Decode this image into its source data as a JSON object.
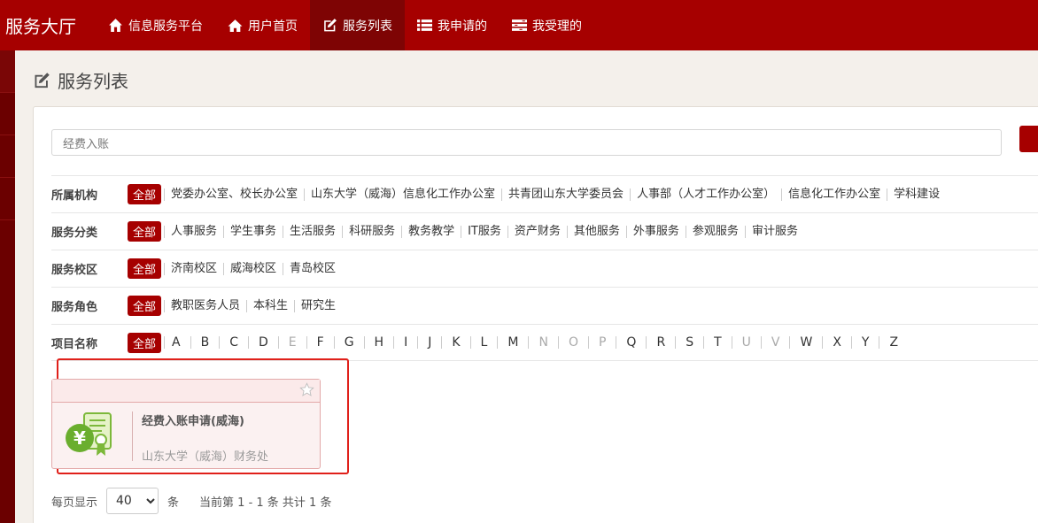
{
  "brand": "服务大厅",
  "nav": [
    {
      "label": "信息服务平台",
      "icon": "home-icon"
    },
    {
      "label": "用户首页",
      "icon": "home-icon"
    },
    {
      "label": "服务列表",
      "icon": "edit-icon",
      "active": true
    },
    {
      "label": "我申请的",
      "icon": "list-icon"
    },
    {
      "label": "我受理的",
      "icon": "tasks-icon"
    }
  ],
  "page_title": "服务列表",
  "search": {
    "value": "经费入账"
  },
  "filters": {
    "all_label": "全部",
    "org": {
      "label": "所属机构",
      "items": [
        "党委办公室、校长办公室",
        "山东大学（威海）信息化工作办公室",
        "共青团山东大学委员会",
        "人事部（人才工作办公室）",
        "信息化工作办公室",
        "学科建设"
      ]
    },
    "category": {
      "label": "服务分类",
      "items": [
        "人事服务",
        "学生事务",
        "生活服务",
        "科研服务",
        "教务教学",
        "IT服务",
        "资产财务",
        "其他服务",
        "外事服务",
        "参观服务",
        "审计服务"
      ]
    },
    "campus": {
      "label": "服务校区",
      "items": [
        "济南校区",
        "威海校区",
        "青岛校区"
      ]
    },
    "role": {
      "label": "服务角色",
      "items": [
        "教职医务人员",
        "本科生",
        "研究生"
      ]
    },
    "name": {
      "label": "项目名称",
      "letters": [
        "A",
        "B",
        "C",
        "D",
        "E",
        "F",
        "G",
        "H",
        "I",
        "J",
        "K",
        "L",
        "M",
        "N",
        "O",
        "P",
        "Q",
        "R",
        "S",
        "T",
        "U",
        "V",
        "W",
        "X",
        "Y",
        "Z"
      ],
      "disabled": [
        "E",
        "N",
        "O",
        "P",
        "U",
        "V"
      ]
    }
  },
  "card": {
    "title": "经费入账申请(威海)",
    "org": "山东大学（威海）财务处"
  },
  "pager": {
    "per_page_label": "每页显示",
    "per_page": "40",
    "unit": "条",
    "info": "当前第 1 - 1 条 共计 1 条"
  },
  "colors": {
    "primary": "#a60000",
    "active_nav": "#7e0404",
    "highlight": "#e0201a"
  }
}
